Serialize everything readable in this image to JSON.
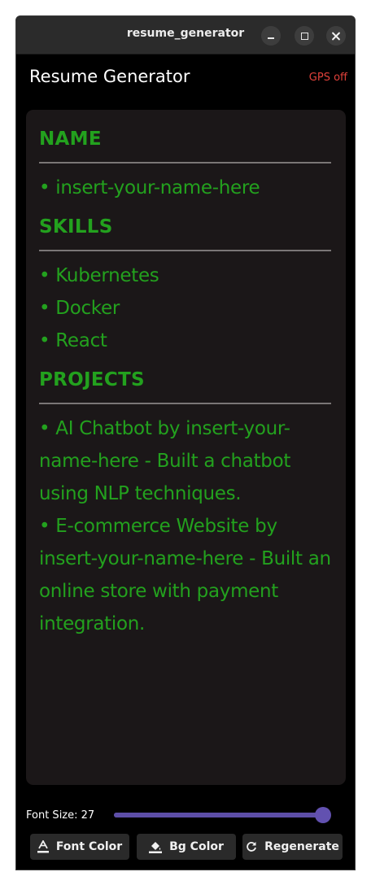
{
  "window": {
    "title": "resume_generator",
    "controls": [
      "minimize-icon",
      "maximize-icon",
      "close-icon"
    ]
  },
  "header": {
    "title": "Resume Generator",
    "gps_status": "GPS off",
    "gps_status_color": "#e0413a"
  },
  "resume": {
    "text_color": "#23a11e",
    "background_color": "#1b1718",
    "sections": [
      {
        "heading": "NAME",
        "entries": [
          "• insert-your-name-here"
        ]
      },
      {
        "heading": "SKILLS",
        "entries": [
          "• Kubernetes",
          "• Docker",
          "• React"
        ]
      },
      {
        "heading": "PROJECTS",
        "entries": [
          "• AI Chatbot by insert-your-name-here - Built a chatbot using NLP techniques.",
          "• E-commerce Website by insert-your-name-here - Built an online store with payment integration."
        ]
      }
    ]
  },
  "controls": {
    "font_size_label": "Font Size: 27",
    "font_size_slider_fraction": 0.995,
    "accent_color": "#6251b0",
    "buttons": {
      "font_color": {
        "label": "Font Color",
        "icon": "text-color-icon"
      },
      "bg_color": {
        "label": "Bg Color",
        "icon": "paint-bucket-icon"
      },
      "regenerate": {
        "label": "Regenerate",
        "icon": "refresh-icon"
      }
    }
  }
}
